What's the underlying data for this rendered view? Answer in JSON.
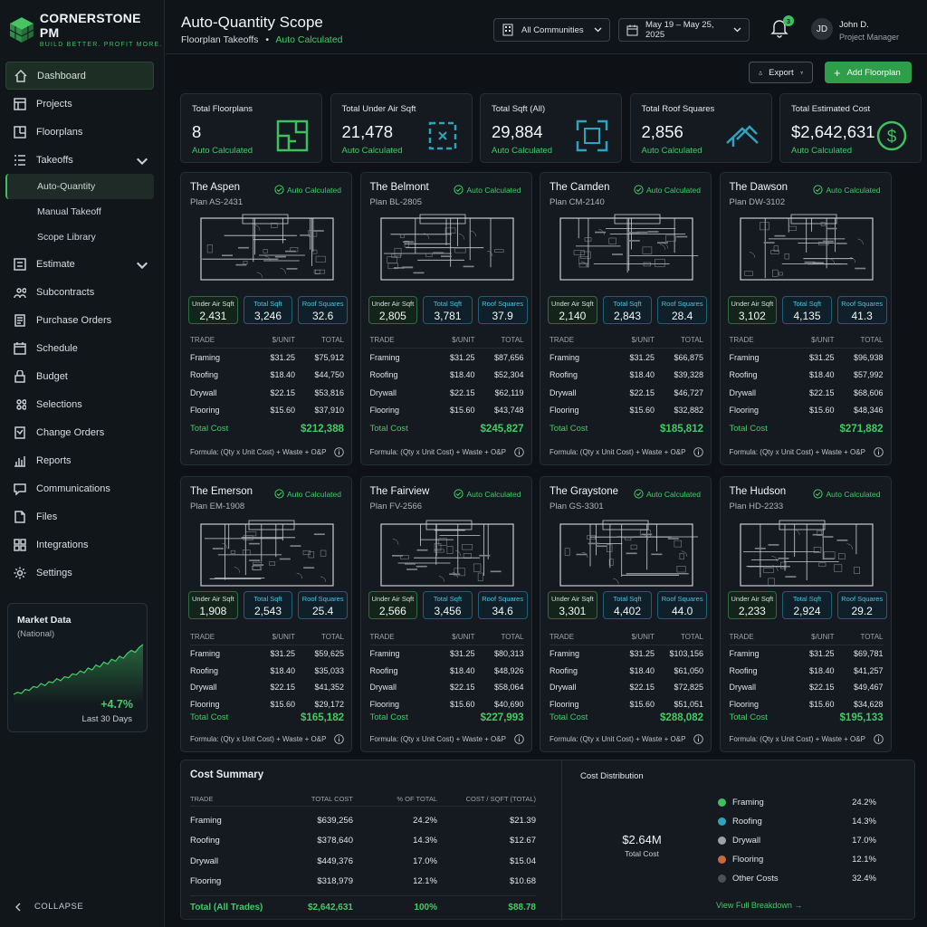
{
  "brand": {
    "name": "CORNERSTONE PM",
    "tagline": "BUILD BETTER. PROFIT MORE."
  },
  "nav": [
    {
      "label": "Dashboard",
      "icon": "home-icon",
      "active": true
    },
    {
      "label": "Projects",
      "icon": "projects-icon"
    },
    {
      "label": "Floorplans",
      "icon": "floorplans-icon"
    },
    {
      "label": "Takeoffs",
      "icon": "takeoffs-icon",
      "expanded": true,
      "children": [
        {
          "label": "Auto-Quantity",
          "active": true
        },
        {
          "label": "Manual Takeoff"
        },
        {
          "label": "Scope Library"
        }
      ]
    },
    {
      "label": "Estimate",
      "icon": "estimate-icon",
      "expandable": true
    },
    {
      "label": "Subcontracts",
      "icon": "subcontracts-icon"
    },
    {
      "label": "Purchase Orders",
      "icon": "purchase-orders-icon"
    },
    {
      "label": "Schedule",
      "icon": "calendar-icon"
    },
    {
      "label": "Budget",
      "icon": "budget-icon"
    },
    {
      "label": "Selections",
      "icon": "selections-icon"
    },
    {
      "label": "Change Orders",
      "icon": "change-orders-icon"
    },
    {
      "label": "Reports",
      "icon": "reports-icon"
    },
    {
      "label": "Communications",
      "icon": "chat-icon"
    },
    {
      "label": "Files",
      "icon": "files-icon"
    },
    {
      "label": "Integrations",
      "icon": "integrations-icon"
    },
    {
      "label": "Settings",
      "icon": "gear-icon"
    }
  ],
  "market": {
    "title": "Market Data",
    "scope": "(National)",
    "change": "+4.7%",
    "period": "Last 30 Days",
    "trend": [
      22,
      24,
      23,
      27,
      26,
      30,
      29,
      33,
      31,
      35,
      34,
      38,
      36,
      40,
      39,
      43,
      42,
      46,
      44,
      49,
      47,
      52,
      50,
      55,
      53,
      58,
      56,
      61,
      59,
      64,
      67,
      65,
      70,
      73
    ]
  },
  "collapse": "COLLAPSE",
  "header": {
    "title": "Auto-Quantity Scope",
    "crumb": "Floorplan Takeoffs",
    "status": "Auto Calculated",
    "communities": "All Communities",
    "dates": "May 19 – May 25, 2025",
    "notifications": "3",
    "initials": "JD",
    "user": "John D.",
    "role": "Project Manager"
  },
  "actions": {
    "export": "Export",
    "add": "Add Floorplan"
  },
  "kpis": [
    {
      "label": "Total Floorplans",
      "value": "8",
      "note": "Auto Calculated",
      "icon": "floorplan-icon"
    },
    {
      "label": "Total Under Air Sqft",
      "value": "21,478",
      "note": "Auto Calculated",
      "icon": "area-icon"
    },
    {
      "label": "Total Sqft (All)",
      "value": "29,884",
      "note": "Auto Calculated",
      "icon": "expand-icon"
    },
    {
      "label": "Total Roof Squares",
      "value": "2,856",
      "note": "Auto Calculated",
      "icon": "roof-icon"
    },
    {
      "label": "Total Estimated Cost",
      "value": "$2,642,631",
      "note": "Auto Calculated",
      "icon": "dollar-icon"
    }
  ],
  "card_labels": {
    "auto": "Auto Calculated",
    "uas": "Under Air Sqft",
    "ts": "Total Sqft",
    "rs": "Roof Squares",
    "trade": "TRADE",
    "unit": "$/UNIT",
    "total": "TOTAL",
    "totalcost": "Total Cost",
    "formula": "Formula: (Qty x Unit Cost) + Waste + O&P"
  },
  "trades": [
    "Framing",
    "Roofing",
    "Drywall",
    "Flooring"
  ],
  "unit_costs": [
    "$31.25",
    "$18.40",
    "$22.15",
    "$15.60"
  ],
  "plans": [
    {
      "name": "The Aspen",
      "code": "Plan AS-2431",
      "uas": "2,431",
      "ts": "3,246",
      "rs": "32.6",
      "totals": [
        "$75,912",
        "$44,750",
        "$53,816",
        "$37,910"
      ],
      "cost": "$212,388"
    },
    {
      "name": "The Belmont",
      "code": "Plan BL-2805",
      "uas": "2,805",
      "ts": "3,781",
      "rs": "37.9",
      "totals": [
        "$87,656",
        "$52,304",
        "$62,119",
        "$43,748"
      ],
      "cost": "$245,827"
    },
    {
      "name": "The Camden",
      "code": "Plan CM-2140",
      "uas": "2,140",
      "ts": "2,843",
      "rs": "28.4",
      "totals": [
        "$66,875",
        "$39,328",
        "$46,727",
        "$32,882"
      ],
      "cost": "$185,812"
    },
    {
      "name": "The Dawson",
      "code": "Plan DW-3102",
      "uas": "3,102",
      "ts": "4,135",
      "rs": "41.3",
      "totals": [
        "$96,938",
        "$57,992",
        "$68,606",
        "$48,346"
      ],
      "cost": "$271,882"
    },
    {
      "name": "The Emerson",
      "code": "Plan EM-1908",
      "uas": "1,908",
      "ts": "2,543",
      "rs": "25.4",
      "totals": [
        "$59,625",
        "$35,033",
        "$41,352",
        "$29,172"
      ],
      "cost": "$165,182"
    },
    {
      "name": "The Fairview",
      "code": "Plan FV-2566",
      "uas": "2,566",
      "ts": "3,456",
      "rs": "34.6",
      "totals": [
        "$80,313",
        "$48,926",
        "$58,064",
        "$40,690"
      ],
      "cost": "$227,993"
    },
    {
      "name": "The Graystone",
      "code": "Plan GS-3301",
      "uas": "3,301",
      "ts": "4,402",
      "rs": "44.0",
      "totals": [
        "$103,156",
        "$61,050",
        "$72,825",
        "$51,051"
      ],
      "cost": "$288,082"
    },
    {
      "name": "The Hudson",
      "code": "Plan HD-2233",
      "uas": "2,233",
      "ts": "2,924",
      "rs": "29.2",
      "totals": [
        "$69,781",
        "$41,257",
        "$49,467",
        "$34,628"
      ],
      "cost": "$195,133"
    }
  ],
  "summary": {
    "title": "Cost Summary",
    "headers": [
      "TRADE",
      "TOTAL COST",
      "% OF TOTAL",
      "COST / SQFT (TOTAL)"
    ],
    "rows": [
      [
        "Framing",
        "$639,256",
        "24.2%",
        "$21.39"
      ],
      [
        "Roofing",
        "$378,640",
        "14.3%",
        "$12.67"
      ],
      [
        "Drywall",
        "$449,376",
        "17.0%",
        "$15.04"
      ],
      [
        "Flooring",
        "$318,979",
        "12.1%",
        "$10.68"
      ]
    ],
    "total": [
      "Total (All Trades)",
      "$2,642,631",
      "100%",
      "$88.78"
    ]
  },
  "distribution": {
    "title": "Cost Distribution",
    "center_value": "$2.64M",
    "center_label": "Total Cost",
    "link": "View Full Breakdown",
    "slices": [
      {
        "name": "Framing",
        "pct": "24.2%",
        "value": 24.2,
        "color": "#3fbf5f"
      },
      {
        "name": "Roofing",
        "pct": "14.3%",
        "value": 14.3,
        "color": "#2fa3bd"
      },
      {
        "name": "Drywall",
        "pct": "17.0%",
        "value": 17.0,
        "color": "#9aa1a8"
      },
      {
        "name": "Flooring",
        "pct": "12.1%",
        "value": 12.1,
        "color": "#c8693a"
      },
      {
        "name": "Other Costs",
        "pct": "32.4%",
        "value": 32.4,
        "color": "#4a5158"
      }
    ]
  }
}
